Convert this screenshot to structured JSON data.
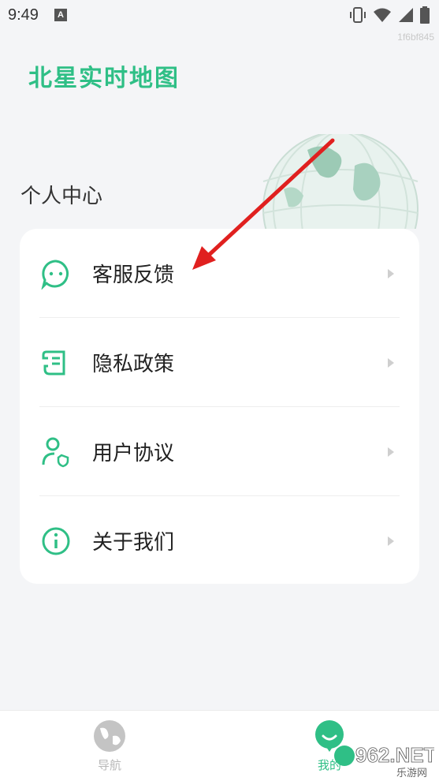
{
  "status_bar": {
    "time": "9:49",
    "notification_letter": "A"
  },
  "build_id": "1f6bf845",
  "app": {
    "title": "北星实时地图"
  },
  "section": {
    "title": "个人中心"
  },
  "menu": [
    {
      "label": "客服反馈",
      "icon": "chat-bubble-icon"
    },
    {
      "label": "隐私政策",
      "icon": "document-scroll-icon"
    },
    {
      "label": "用户协议",
      "icon": "user-shield-icon"
    },
    {
      "label": "关于我们",
      "icon": "info-circle-icon"
    }
  ],
  "bottom_nav": {
    "tabs": [
      {
        "label": "导航",
        "icon": "globe-icon",
        "active": false
      },
      {
        "label": "我的",
        "icon": "profile-face-icon",
        "active": true
      }
    ]
  },
  "watermark": {
    "text": "962.NET",
    "subtext": "乐游网"
  },
  "colors": {
    "accent": "#2fbf86",
    "background": "#f4f5f7",
    "inactive": "#b8b8b8",
    "annotation_arrow": "#e0201f"
  }
}
